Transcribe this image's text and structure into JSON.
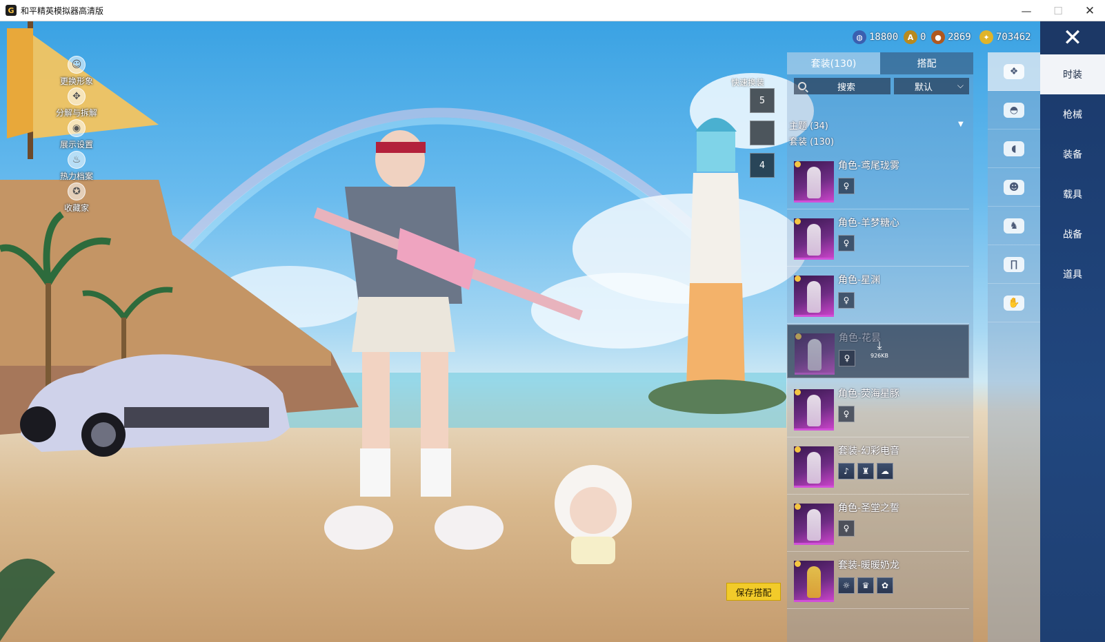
{
  "window": {
    "title": "和平精英模拟器高清版",
    "icon": "G",
    "controls": {
      "minimize": "—",
      "maximize": "☐",
      "close": "✕"
    }
  },
  "left_menu": [
    {
      "label": "更换形象",
      "icon": "avatar-icon",
      "glyph": "☺"
    },
    {
      "label": "分解与拆解",
      "icon": "gear-icon",
      "glyph": "✥"
    },
    {
      "label": "展示设置",
      "icon": "eye-icon",
      "glyph": "◉"
    },
    {
      "label": "热力档案",
      "icon": "flame-icon",
      "glyph": "♨"
    },
    {
      "label": "收藏家",
      "icon": "collector-icon",
      "glyph": "✪"
    }
  ],
  "currency": [
    {
      "value": "18800",
      "icon": "globe-coin-icon",
      "color": "#3a5fb0"
    },
    {
      "value": "0",
      "icon": "a-coin-icon",
      "color": "#b88a1e"
    },
    {
      "value": "2869",
      "icon": "bronze-coin-icon",
      "color": "#b0581e"
    },
    {
      "value": "703462",
      "icon": "gold-coin-icon",
      "color": "#e0b42a"
    }
  ],
  "close_button": "✕",
  "quick_change": {
    "label": "快速换装",
    "slots": [
      "5",
      "",
      "4"
    ]
  },
  "save_button": "保存搭配",
  "panel": {
    "tabs": [
      "套装(130)",
      "搭配"
    ],
    "search_placeholder": "搜索",
    "sort_label": "默认",
    "theme_label": "主题 (34)",
    "set_label": "套装 (130)",
    "items": [
      {
        "name": "角色-鸢尾珑雾",
        "subs": [
          "♀"
        ],
        "selected": false
      },
      {
        "name": "角色-羊梦糖心",
        "subs": [
          "♀"
        ],
        "selected": false
      },
      {
        "name": "角色-星渊",
        "subs": [
          "♀"
        ],
        "selected": false
      },
      {
        "name": "角色-花昙",
        "subs": [
          "♀"
        ],
        "selected": true,
        "download": "926KB"
      },
      {
        "name": "角色-荧海星豚",
        "subs": [
          "♀"
        ],
        "selected": false
      },
      {
        "name": "套装-幻彩电音",
        "subs": [
          "♪",
          "♜",
          "☁"
        ],
        "selected": false
      },
      {
        "name": "角色-圣堂之誓",
        "subs": [
          "♀"
        ],
        "selected": false
      },
      {
        "name": "套装-暖暖奶龙",
        "subs": [
          "☼",
          "♛",
          "✿"
        ],
        "selected": false
      }
    ]
  },
  "categories": [
    {
      "icon": "outfit-icon",
      "glyph": "❖",
      "active": true
    },
    {
      "icon": "cap-icon",
      "glyph": "◓",
      "active": false
    },
    {
      "icon": "mask-icon",
      "glyph": "◖",
      "active": false
    },
    {
      "icon": "face-icon",
      "glyph": "☻",
      "active": false
    },
    {
      "icon": "jacket-icon",
      "glyph": "♞",
      "active": false
    },
    {
      "icon": "pants-icon",
      "glyph": "∏",
      "active": false
    },
    {
      "icon": "gloves-icon",
      "glyph": "✋",
      "active": false
    }
  ],
  "tabs_right": [
    {
      "label": "时装",
      "active": true
    },
    {
      "label": "枪械",
      "active": false
    },
    {
      "label": "装备",
      "active": false
    },
    {
      "label": "载具",
      "active": false
    },
    {
      "label": "战备",
      "active": false
    },
    {
      "label": "道具",
      "active": false
    }
  ]
}
